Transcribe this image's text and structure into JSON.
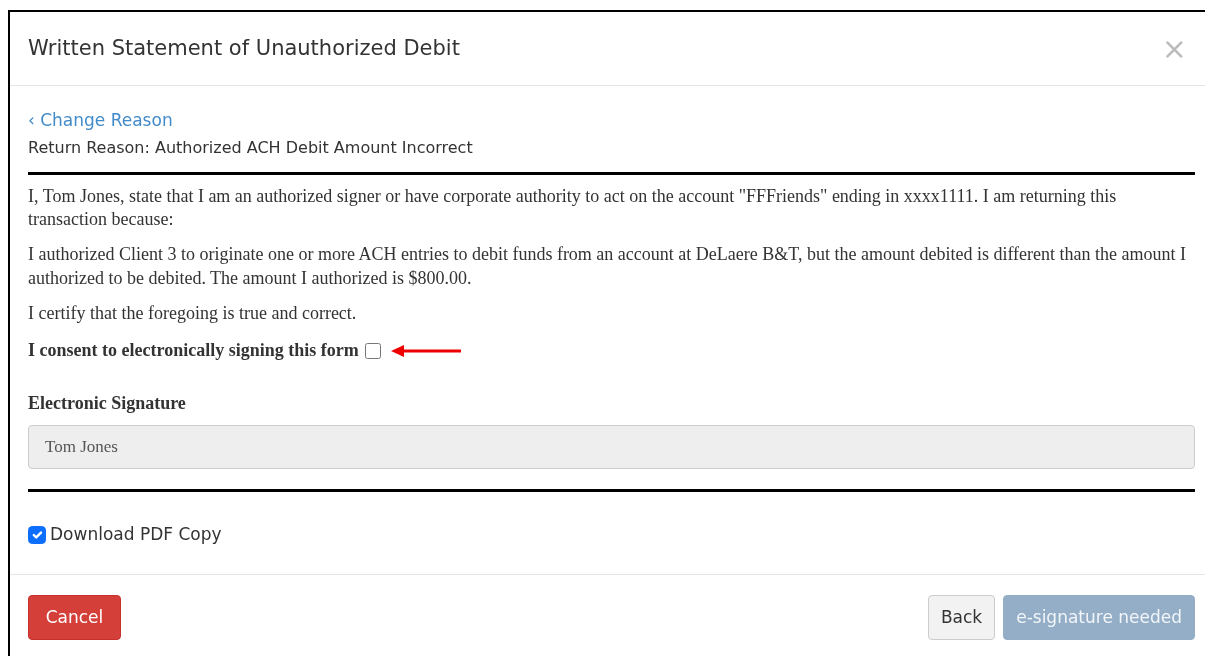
{
  "dialog": {
    "title": "Written Statement of Unauthorized Debit",
    "close": "×"
  },
  "back_link": "‹ Change Reason",
  "return_reason": "Return Reason: Authorized ACH Debit Amount Incorrect",
  "statements": [
    "I, Tom Jones, state that I am an authorized signer or have corporate authority to act on the account \"FFFriends\" ending in xxxx1111. I am returning this transaction because:",
    "I authorized Client 3 to originate one or more ACH entries to debit funds from an account at DeLaere B&T, but the amount debited is different than the amount I authorized to be debited. The amount I authorized is $800.00.",
    "I certify that the foregoing is true and correct."
  ],
  "consent": {
    "label": "I consent to electronically signing this form",
    "checked": false,
    "highlighted": true
  },
  "signature": {
    "label": "Electronic Signature",
    "value": "Tom Jones",
    "disabled": true
  },
  "download": {
    "label": "Download PDF Copy",
    "checked": true
  },
  "buttons": [
    {
      "label": "Cancel",
      "kind": "danger",
      "disabled": false
    },
    {
      "label": "Back",
      "kind": "default",
      "disabled": false
    },
    {
      "label": "e-signature needed",
      "kind": "primary",
      "disabled": true
    }
  ]
}
